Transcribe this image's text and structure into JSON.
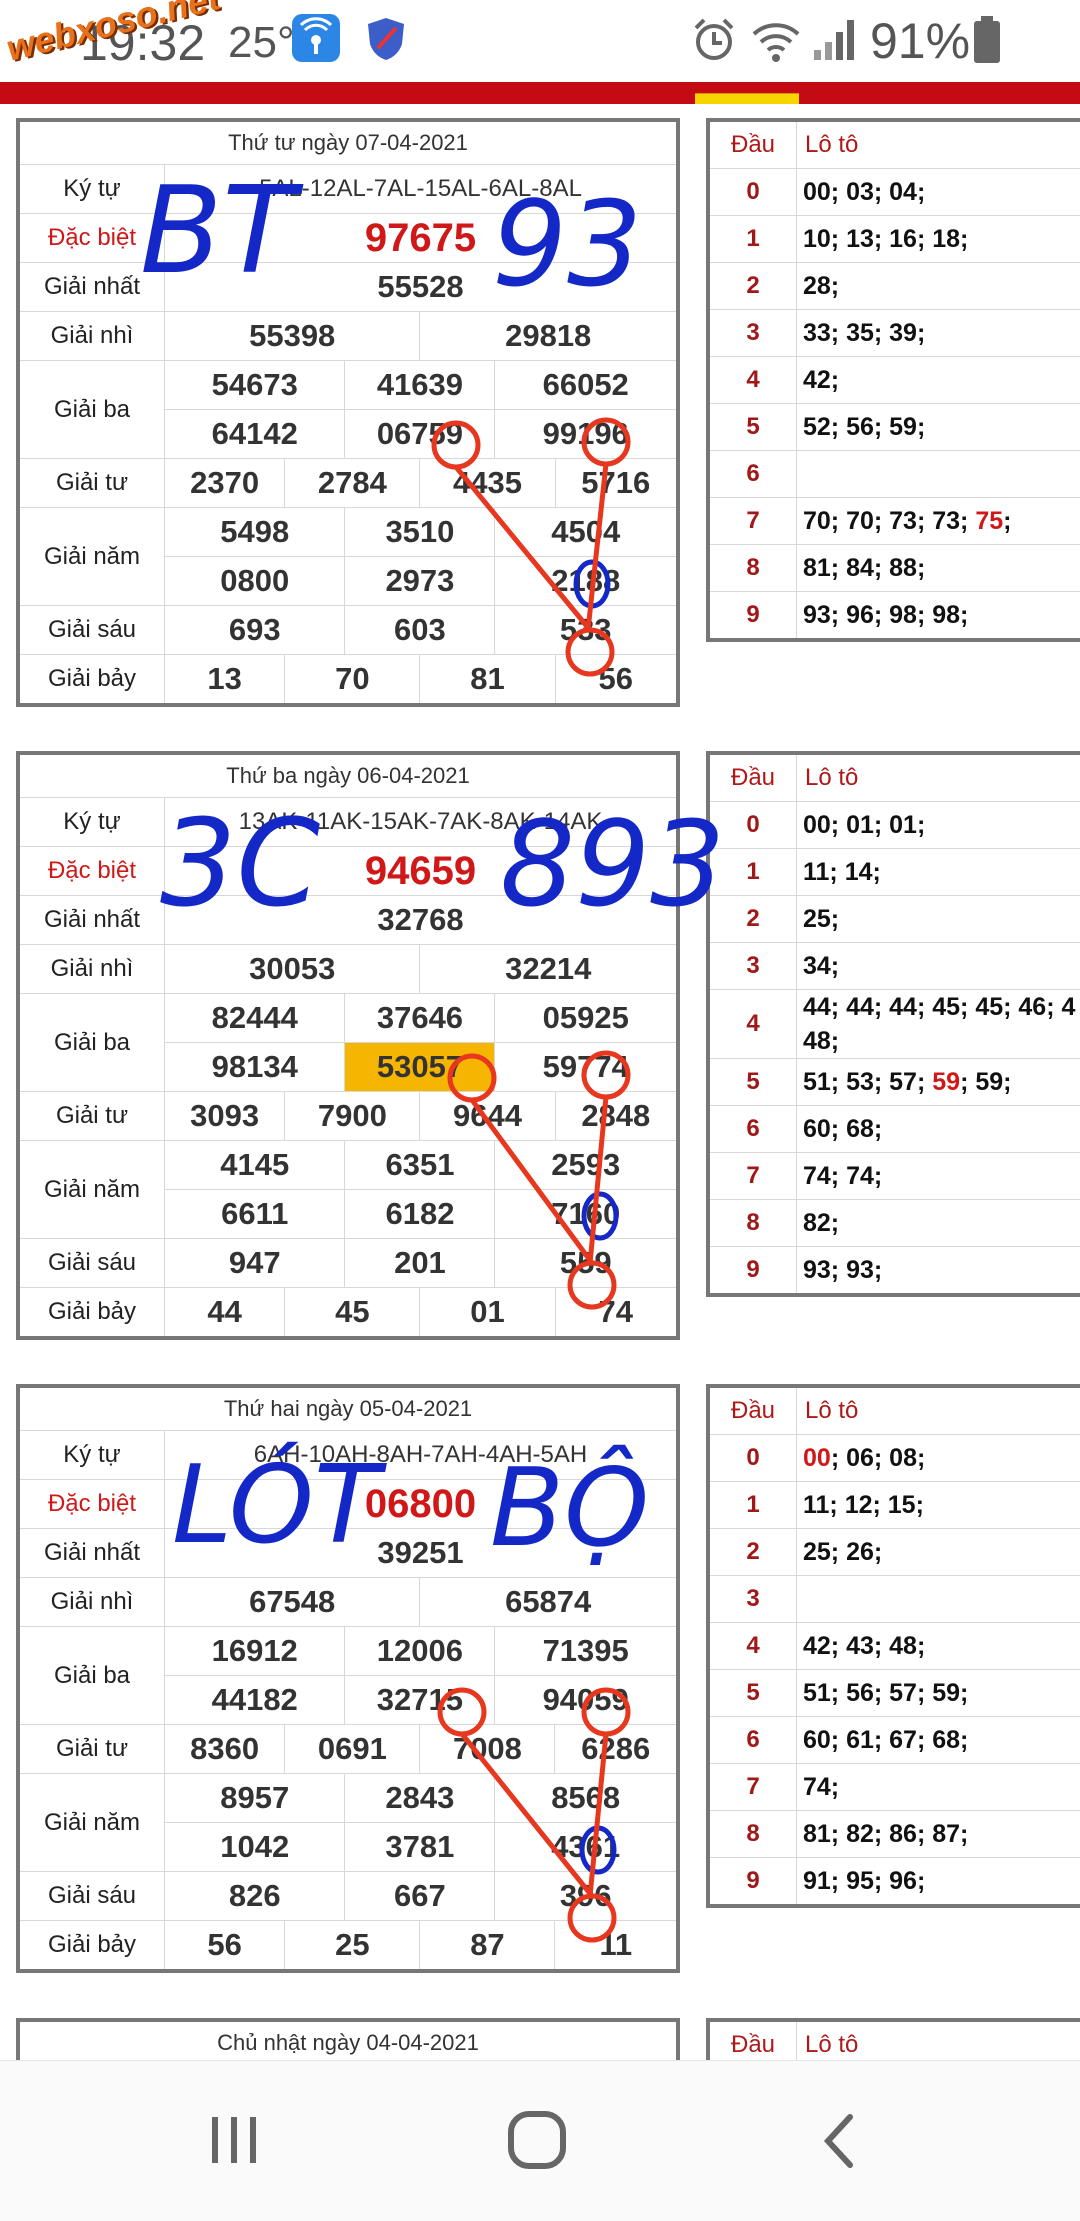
{
  "status_bar": {
    "time": "19:32",
    "temperature": "25°",
    "battery": "91%",
    "site_logo": "webxoso.net"
  },
  "colors": {
    "accent_red": "#d01818",
    "highlight": "#f6b500",
    "ink_blue": "#1428c8",
    "ink_red": "#e8371f"
  },
  "results": [
    {
      "title": "Thứ tư ngày 07-04-2021",
      "labels": {
        "code": "Ký tự",
        "special": "Đặc biệt",
        "first": "Giải nhất",
        "second": "Giải nhì",
        "third": "Giải ba",
        "fourth": "Giải tư",
        "fifth": "Giải năm",
        "sixth": "Giải sáu",
        "seventh": "Giải bảy"
      },
      "code": "5AL-12AL-7AL-15AL-6AL-8AL",
      "special": "97675",
      "first": "55528",
      "second": [
        "55398",
        "29818"
      ],
      "third": [
        "54673",
        "41639",
        "66052",
        "64142",
        "06759",
        "99196"
      ],
      "fourth": [
        "2370",
        "2784",
        "4435",
        "5716"
      ],
      "fifth": [
        "5498",
        "3510",
        "4504",
        "0800",
        "2973",
        "2188"
      ],
      "sixth": [
        "693",
        "603",
        "533"
      ],
      "seventh": [
        "13",
        "70",
        "81",
        "56"
      ],
      "loto_header": {
        "dau": "Đầu",
        "loto": "Lô tô"
      },
      "loto": [
        {
          "d": "0",
          "v": "00; 03; 04;"
        },
        {
          "d": "1",
          "v": "10; 13; 16; 18;"
        },
        {
          "d": "2",
          "v": "28;"
        },
        {
          "d": "3",
          "v": "33; 35; 39;"
        },
        {
          "d": "4",
          "v": "42;"
        },
        {
          "d": "5",
          "v": "52; 56; 59;"
        },
        {
          "d": "6",
          "v": ""
        },
        {
          "d": "7",
          "v": "70; 70; 73; 73;",
          "red": "75",
          "after": ";"
        },
        {
          "d": "8",
          "v": "81; 84; 88;"
        },
        {
          "d": "9",
          "v": "93; 96; 98; 98;"
        }
      ],
      "handwriting": {
        "left": "BT",
        "right": "93"
      }
    },
    {
      "title": "Thứ ba ngày 06-04-2021",
      "labels": {
        "code": "Ký tự",
        "special": "Đặc biệt",
        "first": "Giải nhất",
        "second": "Giải nhì",
        "third": "Giải ba",
        "fourth": "Giải tư",
        "fifth": "Giải năm",
        "sixth": "Giải sáu",
        "seventh": "Giải bảy"
      },
      "code": "13AK-11AK-15AK-7AK-8AK-14AK",
      "special": "94659",
      "first": "32768",
      "second": [
        "30053",
        "32214"
      ],
      "third": [
        "82444",
        "37646",
        "05925",
        "98134",
        "53057",
        "59774"
      ],
      "fourth": [
        "3093",
        "7900",
        "9644",
        "2848"
      ],
      "fifth": [
        "4145",
        "6351",
        "2593",
        "6611",
        "6182",
        "7160"
      ],
      "sixth": [
        "947",
        "201",
        "559"
      ],
      "seventh": [
        "44",
        "45",
        "01",
        "74"
      ],
      "loto_header": {
        "dau": "Đầu",
        "loto": "Lô tô"
      },
      "loto": [
        {
          "d": "0",
          "v": "00; 01; 01;"
        },
        {
          "d": "1",
          "v": "11; 14;"
        },
        {
          "d": "2",
          "v": "25;"
        },
        {
          "d": "3",
          "v": "34;"
        },
        {
          "d": "4",
          "v": "44; 44; 44; 45; 45; 46; 4 48;"
        },
        {
          "d": "5",
          "v": "51; 53; 57;",
          "red": "59",
          "after": "; 59;"
        },
        {
          "d": "6",
          "v": "60; 68;"
        },
        {
          "d": "7",
          "v": "74; 74;"
        },
        {
          "d": "8",
          "v": "82;"
        },
        {
          "d": "9",
          "v": "93; 93;"
        }
      ],
      "handwriting": {
        "left": "3C",
        "right": "893"
      }
    },
    {
      "title": "Thứ hai ngày 05-04-2021",
      "labels": {
        "code": "Ký tự",
        "special": "Đặc biệt",
        "first": "Giải nhất",
        "second": "Giải nhì",
        "third": "Giải ba",
        "fourth": "Giải tư",
        "fifth": "Giải năm",
        "sixth": "Giải sáu",
        "seventh": "Giải bảy"
      },
      "code": "6AH-10AH-8AH-7AH-4AH-5AH",
      "special": "06800",
      "first": "39251",
      "second": [
        "67548",
        "65874"
      ],
      "third": [
        "16912",
        "12006",
        "71395",
        "44182",
        "32715",
        "94059"
      ],
      "fourth": [
        "8360",
        "0691",
        "7008",
        "6286"
      ],
      "fifth": [
        "8957",
        "2843",
        "8568",
        "1042",
        "3781",
        "4361"
      ],
      "sixth": [
        "826",
        "667",
        "396"
      ],
      "seventh": [
        "56",
        "25",
        "87",
        "11"
      ],
      "loto_header": {
        "dau": "Đầu",
        "loto": "Lô tô"
      },
      "loto": [
        {
          "d": "0",
          "red_first": "00",
          "v": "; 06; 08;"
        },
        {
          "d": "1",
          "v": "11; 12; 15;"
        },
        {
          "d": "2",
          "v": "25; 26;"
        },
        {
          "d": "3",
          "v": ""
        },
        {
          "d": "4",
          "v": "42; 43; 48;"
        },
        {
          "d": "5",
          "v": "51; 56; 57; 59;"
        },
        {
          "d": "6",
          "v": "60; 61; 67; 68;"
        },
        {
          "d": "7",
          "v": "74;"
        },
        {
          "d": "8",
          "v": "81; 82; 86; 87;"
        },
        {
          "d": "9",
          "v": "91; 95; 96;"
        }
      ],
      "handwriting": {
        "left": "LÓT",
        "right": "BỘ"
      }
    },
    {
      "title": "Chủ nhật ngày 04-04-2021",
      "loto_header": {
        "dau": "Đầu",
        "loto": "Lô tô"
      }
    }
  ],
  "navbar": {
    "recent": "recent-apps",
    "home": "home",
    "back": "back"
  }
}
